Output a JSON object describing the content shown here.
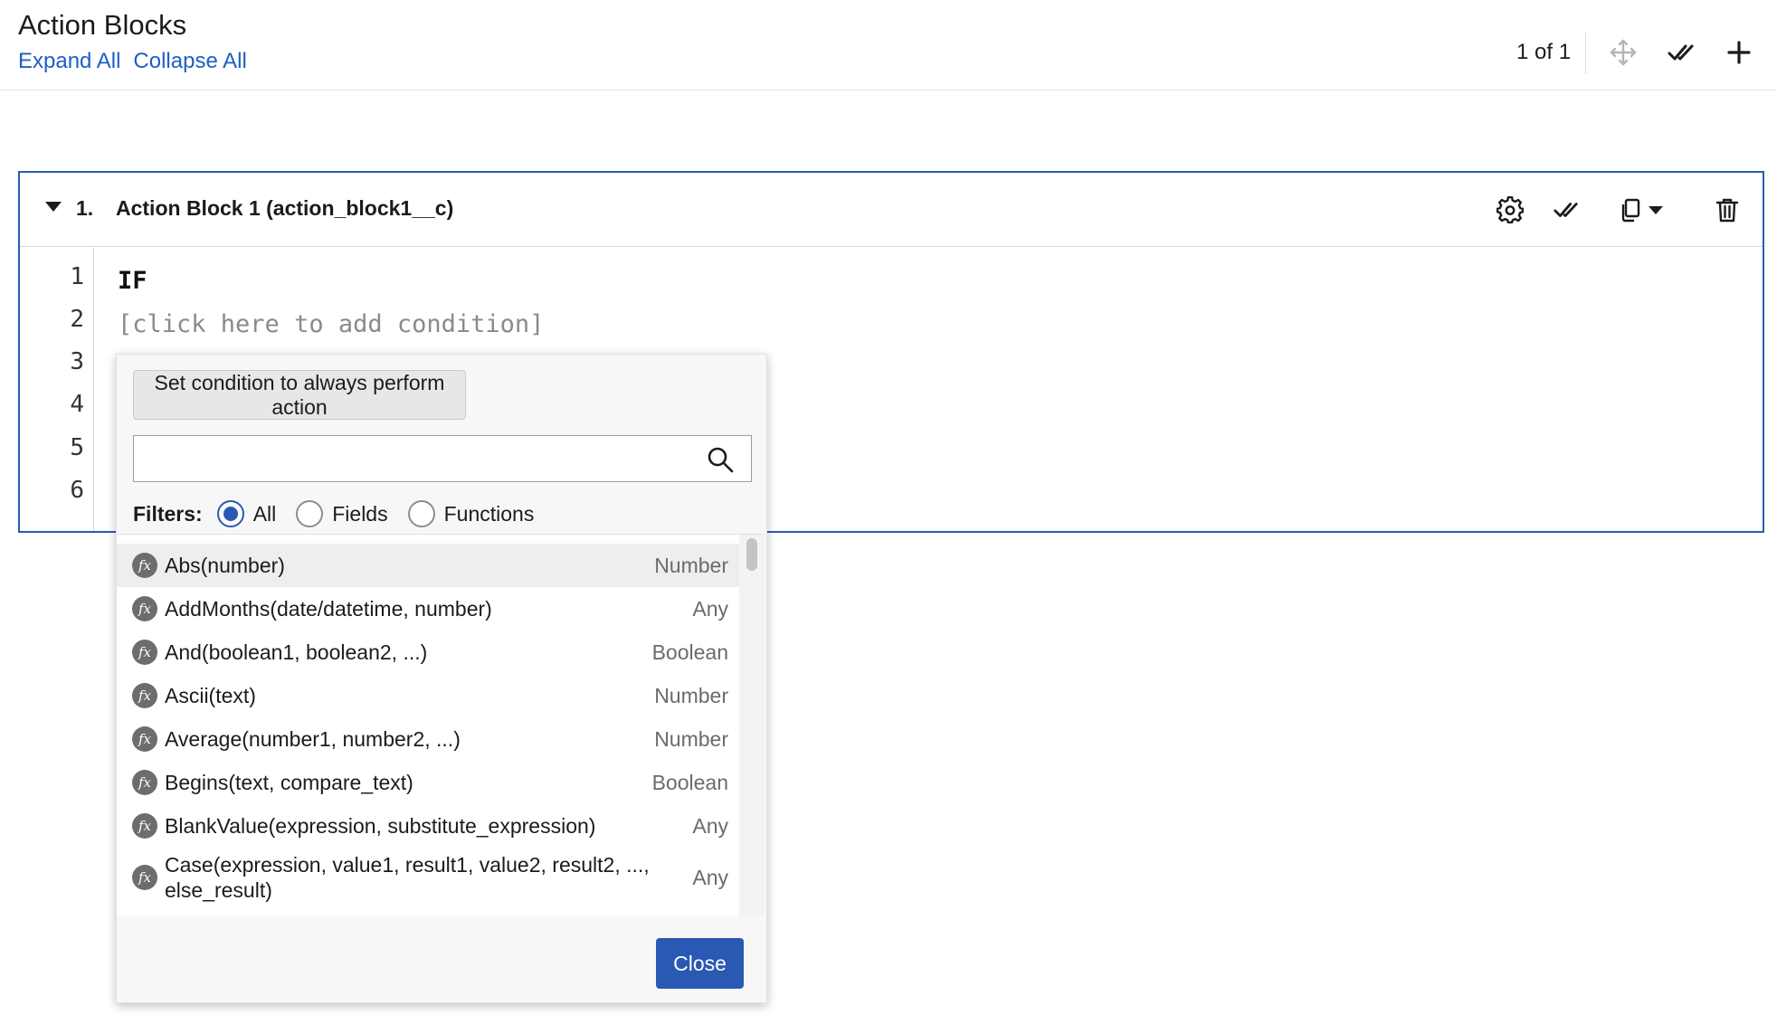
{
  "header": {
    "title": "Action Blocks",
    "expand_all": "Expand All",
    "collapse_all": "Collapse All",
    "pager": "1 of 1"
  },
  "block": {
    "number": "1.",
    "name": "Action Block 1 (action_block1__c)",
    "line_numbers": [
      "1",
      "2",
      "3",
      "4",
      "5",
      "6"
    ],
    "code_line1": "IF",
    "code_line2": "[click here to add condition]"
  },
  "popup": {
    "always_button": "Set condition to always perform action",
    "search_value": "",
    "search_placeholder": "",
    "filters_label": "Filters:",
    "filter_options": [
      "All",
      "Fields",
      "Functions"
    ],
    "selected_filter": "All",
    "close_label": "Close",
    "functions": [
      {
        "name": "Abs(number)",
        "type": "Number"
      },
      {
        "name": "AddMonths(date/datetime, number)",
        "type": "Any"
      },
      {
        "name": "And(boolean1, boolean2, ...)",
        "type": "Boolean"
      },
      {
        "name": "Ascii(text)",
        "type": "Number"
      },
      {
        "name": "Average(number1, number2, ...)",
        "type": "Number"
      },
      {
        "name": "Begins(text, compare_text)",
        "type": "Boolean"
      },
      {
        "name": "BlankValue(expression, substitute_expression)",
        "type": "Any"
      },
      {
        "name": "Case(expression, value1, result1, value2, result2, ..., else_result)",
        "type": "Any"
      }
    ]
  },
  "colors": {
    "accent": "#2a59b3",
    "link": "#1e5fc4"
  }
}
